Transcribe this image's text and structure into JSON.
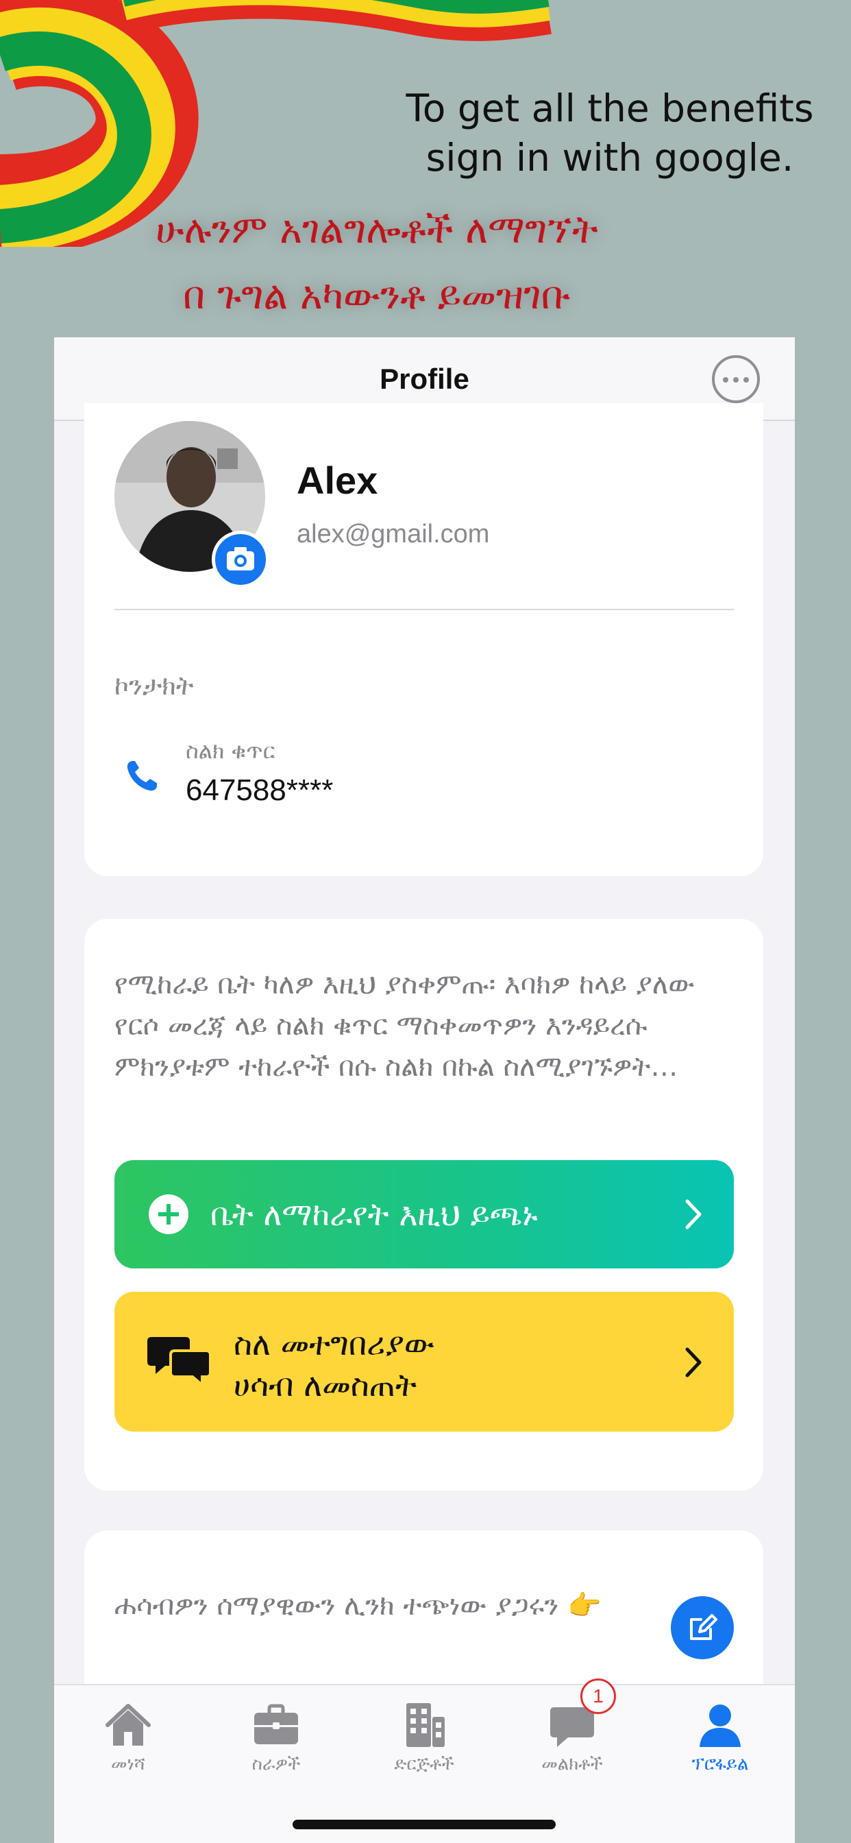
{
  "promo": {
    "english": "To get all the benefits\nsign in with google.",
    "amharic": "ሁሉንም አገልግሎቶች ለማግኘት\nበ ጉግል አካውንቶ ይመዝገቡ"
  },
  "navbar": {
    "title": "Profile",
    "more_icon": "ellipsis-circle-icon"
  },
  "profile": {
    "name": "Alex",
    "email": "alex@gmail.com",
    "camera_icon": "camera-icon"
  },
  "contact": {
    "heading": "ኮንታክት",
    "phone_label": "ስልክ ቁጥር",
    "phone_value": "647588****",
    "phone_icon": "phone-icon"
  },
  "actions": {
    "info_text": "የሚከራይ ቤት ካለዎ እዚህ ያስቀምጡ፡ እባክዎ ከላይ ያለው የርሶ መረጃ ላይ ስልክ ቁጥር ማስቀመጥዎን እንዳይረሱ ምክንያቱም ተከራዮች በሱ ስልክ በኩል ስለሚያገኙዎት…",
    "add_house_label": "ቤት ለማከራየት እዚህ ይጫኑ",
    "feedback_label": "ስለ መተግበሪያው\nሀሳብ ለመስጠት"
  },
  "feedback": {
    "text": "ሐሳብዎን ሰማያዊውን ሊንክ ተጭነው ያጋሩን 👉",
    "edit_icon": "edit-icon"
  },
  "tabs": [
    {
      "label": "መነሻ",
      "icon": "home-icon",
      "active": false
    },
    {
      "label": "ስራዎች",
      "icon": "briefcase-icon",
      "active": false
    },
    {
      "label": "ድርጅቶች",
      "icon": "building-icon",
      "active": false
    },
    {
      "label": "መልክቶች",
      "icon": "chat-icon",
      "active": false,
      "badge": "1"
    },
    {
      "label": "ፕሮፋይል",
      "icon": "person-icon",
      "active": true
    }
  ],
  "colors": {
    "accent": "#1576f0",
    "green_start": "#2ec561",
    "green_end": "#09c4b4",
    "yellow": "#ffd63a",
    "promo_red": "#c0141b",
    "background": "#a7b9b7"
  }
}
